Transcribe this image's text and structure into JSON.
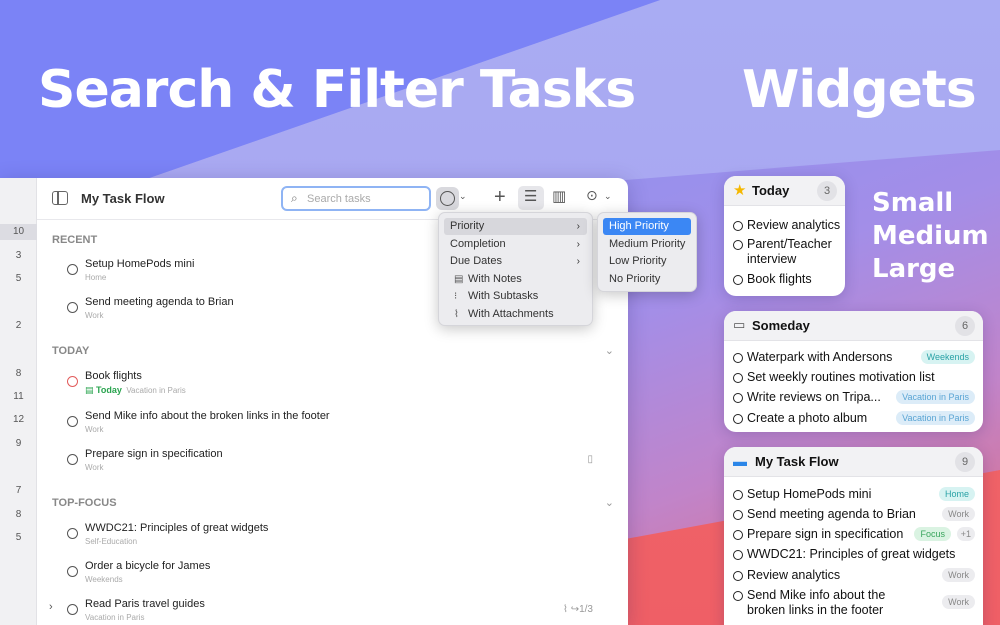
{
  "colors": {
    "accent": "#3b87f4",
    "today_green": "#2aa44f",
    "overdue_red": "#e25c5c"
  },
  "headline_left": "Search & Filter Tasks",
  "headline_right": "Widgets",
  "sizes": [
    "Small",
    "Medium",
    "Large"
  ],
  "app": {
    "title": "My Task Flow",
    "search_placeholder": "Search tasks",
    "gutter_numbers": [
      "10",
      "3",
      "5",
      "2",
      "8",
      "11",
      "12",
      "9",
      "7",
      "8",
      "5"
    ],
    "sections": [
      {
        "name": "RECENT",
        "tasks": [
          {
            "title": "Setup HomePods mini",
            "sub": "Home"
          },
          {
            "title": "Send meeting agenda to Brian",
            "sub": "Work"
          }
        ]
      },
      {
        "name": "TODAY",
        "tasks": [
          {
            "title": "Book flights",
            "today": "Today",
            "sub": "Vacation in Paris"
          },
          {
            "title": "Send Mike info about the broken links in the footer",
            "sub": "Work"
          },
          {
            "title": "Prepare sign in specification",
            "sub": "Work"
          }
        ]
      },
      {
        "name": "TOP-FOCUS",
        "tasks": [
          {
            "title": "WWDC21: Principles of great widgets",
            "sub": "Self-Education"
          },
          {
            "title": "Order a bicycle for James",
            "sub": "Weekends"
          },
          {
            "title": "Read Paris travel guides",
            "sub": "Vacation in Paris",
            "progress": "1/3"
          }
        ]
      }
    ]
  },
  "filter_menu": {
    "items": [
      "Priority",
      "Completion",
      "Due Dates",
      "With Notes",
      "With Subtasks",
      "With Attachments"
    ],
    "submenu": [
      "High Priority",
      "Medium Priority",
      "Low Priority",
      "No Priority"
    ]
  },
  "widgets": {
    "small": {
      "title": "Today",
      "count": "3",
      "items": [
        "Review analytics",
        "Parent/Teacher",
        "interview",
        "Book flights"
      ]
    },
    "medium": {
      "title": "Someday",
      "count": "6",
      "items": [
        {
          "text": "Waterpark with Andersons",
          "tag": "Weekends"
        },
        {
          "text": "Set weekly routines motivation list",
          "tag": ""
        },
        {
          "text": "Write reviews on Tripa...",
          "tag": "Vacation in Paris"
        },
        {
          "text": "Create a photo album",
          "tag": "Vacation in Paris"
        }
      ]
    },
    "large": {
      "title": "My Task Flow",
      "count": "9",
      "items": [
        {
          "text": "Setup HomePods mini",
          "tag": "Home"
        },
        {
          "text": "Send meeting agenda to Brian",
          "tag": "Work"
        },
        {
          "text": "Prepare sign in specification",
          "tag": "Focus",
          "extra": "+1"
        },
        {
          "text": "WWDC21: Principles of great widgets",
          "tag": ""
        },
        {
          "text": "Review analytics",
          "tag": "Work"
        },
        {
          "text": "Send Mike info about the",
          "text2": "broken links in the footer",
          "tag": "Work"
        }
      ]
    }
  }
}
